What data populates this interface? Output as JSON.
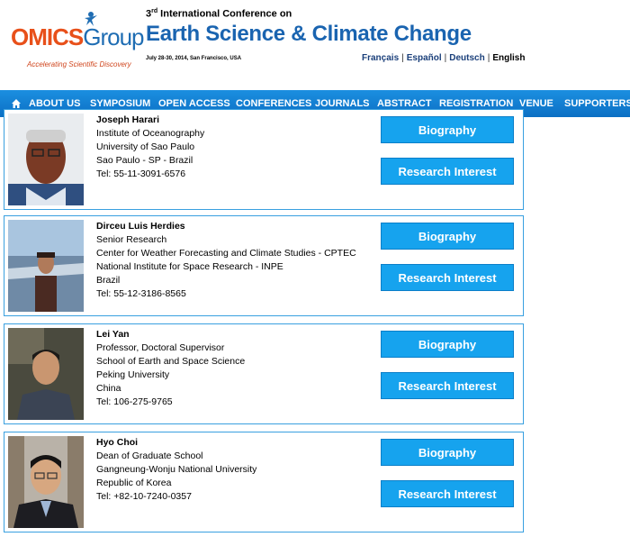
{
  "header": {
    "logo": {
      "brand_a": "OMICS",
      "brand_b": "Group",
      "tagline": "Accelerating Scientific Discovery"
    },
    "conference_ordinal": "3",
    "conference_ordinal_suffix": "rd",
    "conference_line": " International Conference on",
    "conference_title": "Earth Science & Climate Change",
    "conference_date": "July 28-30, 2014, San Francisco, USA",
    "languages": [
      "Français",
      "Español",
      "Deutsch",
      "English"
    ]
  },
  "nav": {
    "items": [
      "ABOUT US",
      "SYMPOSIUM",
      "OPEN ACCESS",
      "CONFERENCES",
      "JOURNALS",
      "ABSTRACT",
      "REGISTRATION",
      "VENUE",
      "SUPPORTERS"
    ]
  },
  "speakers": [
    {
      "name": "Joseph Harari",
      "lines": [
        "Institute of Oceanography",
        "University of Sao Paulo",
        "Sao Paulo - SP - Brazil",
        "Tel: 55-11-3091-6576"
      ],
      "biography_label": "Biography",
      "research_label": "Research Interest"
    },
    {
      "name": "Dirceu Luis Herdies",
      "lines": [
        "Senior Research",
        "Center for Weather Forecasting and Climate Studies - CPTEC",
        "National Institute for Space Research - INPE",
        "Brazil",
        "Tel: 55-12-3186-8565"
      ],
      "biography_label": "Biography",
      "research_label": "Research Interest"
    },
    {
      "name": "Lei Yan",
      "lines": [
        "Professor, Doctoral Supervisor",
        "School of Earth and Space Science",
        "Peking University",
        "China",
        "Tel: 106-275-9765"
      ],
      "biography_label": "Biography",
      "research_label": "Research Interest"
    },
    {
      "name": "Hyo Choi",
      "lines": [
        "Dean of Graduate School",
        "Gangneung-Wonju National University",
        "Republic of Korea",
        "Tel: +82-10-7240-0357"
      ],
      "biography_label": "Biography",
      "research_label": "Research Interest"
    }
  ],
  "colors": {
    "nav": "#1b8fe0",
    "title": "#1a64b0",
    "button": "#16a3ee",
    "card_border": "#39a0e0",
    "logo_orange": "#e8501a"
  },
  "icons": {
    "home": "home-icon"
  }
}
